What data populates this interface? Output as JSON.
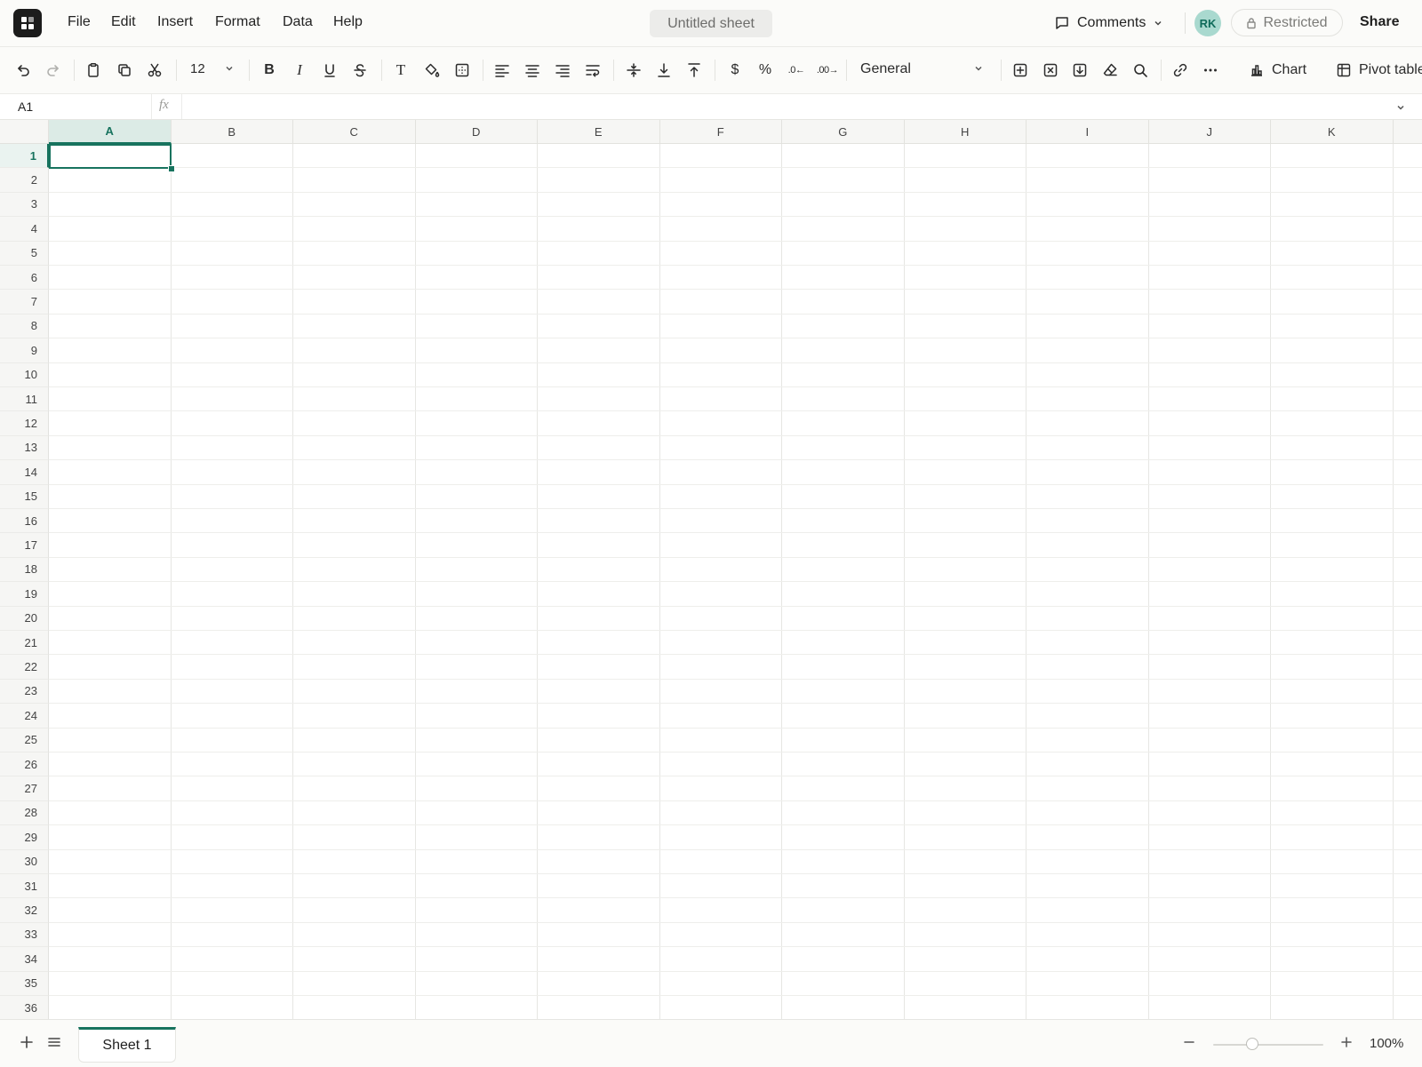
{
  "menu": [
    "File",
    "Edit",
    "Insert",
    "Format",
    "Data",
    "Help"
  ],
  "document_title": "Untitled sheet",
  "header": {
    "comments_label": "Comments",
    "avatar_initials": "RK",
    "access_label": "Restricted",
    "share_label": "Share"
  },
  "toolbar": {
    "font_size": "12",
    "text_style_glyph": "T",
    "currency_glyph": "$",
    "percent_glyph": "%",
    "decrease_decimals_glyph": ".0←",
    "increase_decimals_glyph": ".00→",
    "number_format": "General",
    "chart_label": "Chart",
    "pivot_label": "Pivot table"
  },
  "formula_bar": {
    "cell_reference": "A1",
    "fx_label": "fx",
    "formula": ""
  },
  "grid": {
    "columns": [
      "A",
      "B",
      "C",
      "D",
      "E",
      "F",
      "G",
      "H",
      "I",
      "J",
      "K"
    ],
    "rows": [
      "1",
      "2",
      "3",
      "4",
      "5",
      "6",
      "7",
      "8",
      "9",
      "10",
      "11",
      "12",
      "13",
      "14",
      "15",
      "16",
      "17",
      "18",
      "19",
      "20",
      "21",
      "22",
      "23",
      "24",
      "25",
      "26",
      "27",
      "28",
      "29",
      "30",
      "31",
      "32",
      "33",
      "34",
      "35",
      "36"
    ],
    "selected_column": "A",
    "selected_row": "1"
  },
  "sheets": {
    "tabs": [
      "Sheet 1"
    ],
    "active": "Sheet 1"
  },
  "zoom": {
    "level_label": "100%",
    "level": 100
  },
  "colors": {
    "accent": "#17735e",
    "avatar_bg": "#a9d9cf",
    "header_bg": "#f6f6f4",
    "bar_bg": "#fbfbf9"
  },
  "icons": [
    "app-logo-icon",
    "undo-icon",
    "redo-icon",
    "paste-icon",
    "copy-icon",
    "cut-icon",
    "bold-icon",
    "italic-icon",
    "underline-icon",
    "strikethrough-icon",
    "fill-color-icon",
    "borders-icon",
    "align-left-icon",
    "align-center-icon",
    "align-right-icon",
    "wrap-text-icon",
    "vertical-align-middle-icon",
    "vertical-align-bottom-icon",
    "vertical-align-top-icon",
    "insert-cells-icon",
    "delete-cells-icon",
    "import-icon",
    "clear-format-icon",
    "search-icon",
    "link-icon",
    "more-icon",
    "chart-icon",
    "pivot-table-icon",
    "comment-icon",
    "lock-icon"
  ]
}
